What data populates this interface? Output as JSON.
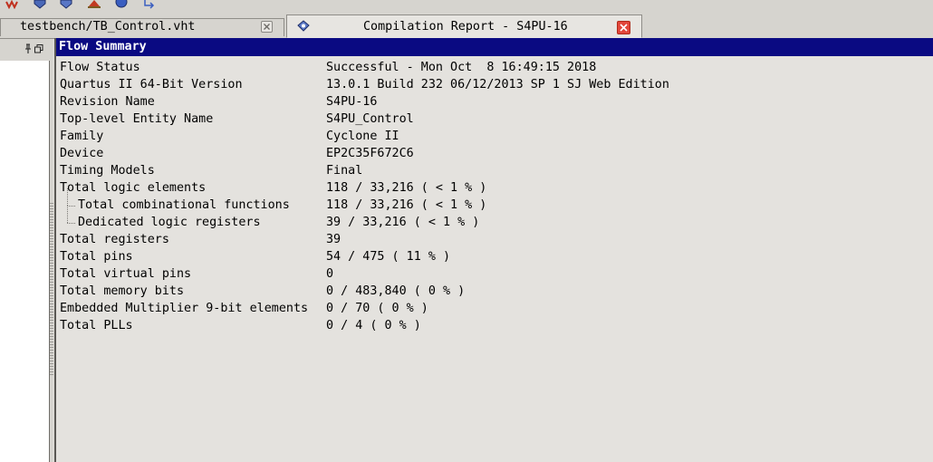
{
  "toolbar": {
    "icons": [
      "waveform-icon",
      "chip-download-icon",
      "chip-program-icon",
      "chip-warning-icon",
      "help-icon",
      "arrow-icon"
    ]
  },
  "tabs": [
    {
      "label": "testbench/TB_Control.vht",
      "active": false
    },
    {
      "label": "Compilation Report - S4PU-16",
      "active": true
    }
  ],
  "report": {
    "title": "Flow Summary",
    "rows": [
      {
        "key": "Flow Status",
        "value": "Successful - Mon Oct  8 16:49:15 2018",
        "child": false
      },
      {
        "key": "Quartus II 64-Bit Version",
        "value": "13.0.1 Build 232 06/12/2013 SP 1 SJ Web Edition",
        "child": false
      },
      {
        "key": "Revision Name",
        "value": "S4PU-16",
        "child": false
      },
      {
        "key": "Top-level Entity Name",
        "value": "S4PU_Control",
        "child": false
      },
      {
        "key": "Family",
        "value": "Cyclone II",
        "child": false
      },
      {
        "key": "Device",
        "value": "EP2C35F672C6",
        "child": false
      },
      {
        "key": "Timing Models",
        "value": "Final",
        "child": false
      },
      {
        "key": "Total logic elements",
        "value": "118 / 33,216 ( < 1 % )",
        "child": false
      },
      {
        "key": "Total combinational functions",
        "value": "118 / 33,216 ( < 1 % )",
        "child": true
      },
      {
        "key": "Dedicated logic registers",
        "value": "39 / 33,216 ( < 1 % )",
        "child": true
      },
      {
        "key": "Total registers",
        "value": "39",
        "child": false
      },
      {
        "key": "Total pins",
        "value": "54 / 475 ( 11 % )",
        "child": false
      },
      {
        "key": "Total virtual pins",
        "value": "0",
        "child": false
      },
      {
        "key": "Total memory bits",
        "value": "0 / 483,840 ( 0 % )",
        "child": false
      },
      {
        "key": "Embedded Multiplier 9-bit elements",
        "value": "0 / 70 ( 0 % )",
        "child": false
      },
      {
        "key": "Total PLLs",
        "value": "0 / 4 ( 0 % )",
        "child": false
      }
    ]
  },
  "colors": {
    "title_bar": "#0a0a82",
    "close_active": "#e2463a",
    "background": "#dcdad5"
  }
}
